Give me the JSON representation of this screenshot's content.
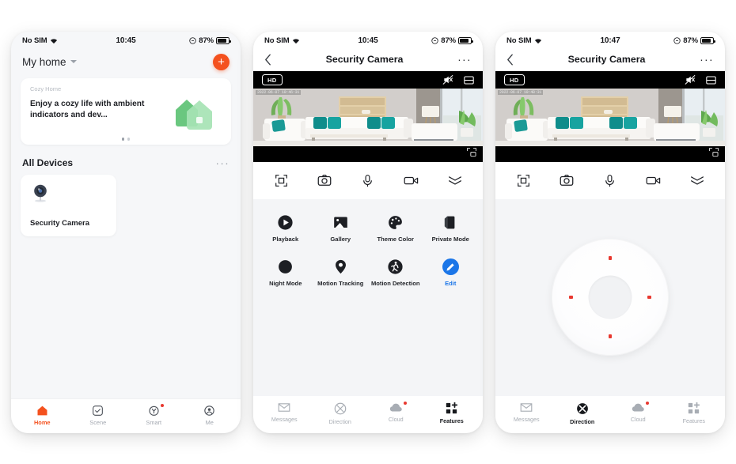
{
  "screens": [
    {
      "id": "home",
      "status": {
        "carrier": "No SIM",
        "time": "10:45",
        "battery": "87%",
        "wifi_icon": "wifi-icon",
        "lock_icon": "rotation-lock-icon"
      },
      "header": {
        "title": "My home",
        "caret_icon": "chevron-down-icon",
        "add_label": "+",
        "add_icon": "plus-icon"
      },
      "banner": {
        "kicker": "Cozy Home",
        "headline": "Enjoy a cozy life with ambient indicators and dev...",
        "art_icon": "green-house-illustration",
        "dots": 2,
        "active_dot": 0
      },
      "devices_section": {
        "title": "All Devices",
        "more_icon": "more-horizontal-icon",
        "more_label": "···"
      },
      "devices": [
        {
          "name": "Security Camera",
          "icon": "security-camera-icon"
        }
      ],
      "tabs": [
        {
          "label": "Home",
          "icon": "home-icon",
          "active": true,
          "badge": false
        },
        {
          "label": "Scene",
          "icon": "scene-check-icon",
          "active": false,
          "badge": false
        },
        {
          "label": "Smart",
          "icon": "smart-clock-icon",
          "active": false,
          "badge": true
        },
        {
          "label": "Me",
          "icon": "account-icon",
          "active": false,
          "badge": false
        }
      ]
    },
    {
      "id": "camera-features",
      "status": {
        "carrier": "No SIM",
        "time": "10:45",
        "battery": "87%",
        "wifi_icon": "wifi-icon",
        "lock_icon": "rotation-lock-icon"
      },
      "nav": {
        "back_icon": "chevron-left-icon",
        "title": "Security Camera",
        "more_icon": "more-horizontal-icon",
        "more_label": "···"
      },
      "video": {
        "quality_label": "HD",
        "mute_icon": "speaker-muted-icon",
        "layout_icon": "split-layout-icon",
        "timestamp": "2022-06-07 10:46:31",
        "pip_icon": "picture-in-picture-icon",
        "scene_description": "living room"
      },
      "controls": [
        {
          "icon": "fullscreen-icon"
        },
        {
          "icon": "camera-snapshot-icon"
        },
        {
          "icon": "microphone-icon"
        },
        {
          "icon": "video-record-icon"
        },
        {
          "icon": "double-chevron-down-icon"
        }
      ],
      "features": [
        {
          "label": "Playback",
          "icon": "playback-icon",
          "highlight": false
        },
        {
          "label": "Gallery",
          "icon": "gallery-icon",
          "highlight": false
        },
        {
          "label": "Theme Color",
          "icon": "theme-color-icon",
          "highlight": false
        },
        {
          "label": "Private Mode",
          "icon": "private-mode-icon",
          "highlight": false
        },
        {
          "label": "Night Mode",
          "icon": "night-mode-icon",
          "highlight": false
        },
        {
          "label": "Motion Tracking",
          "icon": "motion-tracking-icon",
          "highlight": false
        },
        {
          "label": "Motion Detection",
          "icon": "motion-detection-icon",
          "highlight": false
        },
        {
          "label": "Edit",
          "icon": "edit-pencil-icon",
          "highlight": true
        }
      ],
      "tabs": [
        {
          "label": "Messages",
          "icon": "messages-icon",
          "active": false,
          "badge": false
        },
        {
          "label": "Direction",
          "icon": "direction-icon",
          "active": false,
          "badge": false
        },
        {
          "label": "Cloud",
          "icon": "cloud-icon",
          "active": false,
          "badge": true
        },
        {
          "label": "Features",
          "icon": "features-grid-icon",
          "active": true,
          "badge": false
        }
      ]
    },
    {
      "id": "camera-direction",
      "status": {
        "carrier": "No SIM",
        "time": "10:47",
        "battery": "87%",
        "wifi_icon": "wifi-icon",
        "lock_icon": "rotation-lock-icon"
      },
      "nav": {
        "back_icon": "chevron-left-icon",
        "title": "Security Camera",
        "more_icon": "more-horizontal-icon",
        "more_label": "···"
      },
      "video": {
        "quality_label": "HD",
        "mute_icon": "speaker-muted-icon",
        "layout_icon": "split-layout-icon",
        "timestamp": "2022-06-07 10:48:31",
        "pip_icon": "picture-in-picture-icon",
        "scene_description": "living room"
      },
      "controls": [
        {
          "icon": "fullscreen-icon"
        },
        {
          "icon": "camera-snapshot-icon"
        },
        {
          "icon": "microphone-icon"
        },
        {
          "icon": "video-record-icon"
        },
        {
          "icon": "double-chevron-down-icon"
        }
      ],
      "dpad": {
        "name": "direction-pad",
        "up_icon": "dpad-up-icon",
        "down_icon": "dpad-down-icon",
        "left_icon": "dpad-left-icon",
        "right_icon": "dpad-right-icon",
        "center_icon": "dpad-center-icon"
      },
      "tabs": [
        {
          "label": "Messages",
          "icon": "messages-icon",
          "active": false,
          "badge": false
        },
        {
          "label": "Direction",
          "icon": "direction-icon",
          "active": true,
          "badge": false
        },
        {
          "label": "Cloud",
          "icon": "cloud-icon",
          "active": false,
          "badge": true
        },
        {
          "label": "Features",
          "icon": "features-grid-icon",
          "active": false,
          "badge": false
        }
      ]
    }
  ],
  "colors": {
    "accent_orange": "#f4511e",
    "accent_blue": "#1b76e8",
    "badge_red": "#e8382f",
    "panel_bg": "#f4f5f7",
    "text_dark": "#1d1f24",
    "text_muted": "#a3a8b0"
  }
}
